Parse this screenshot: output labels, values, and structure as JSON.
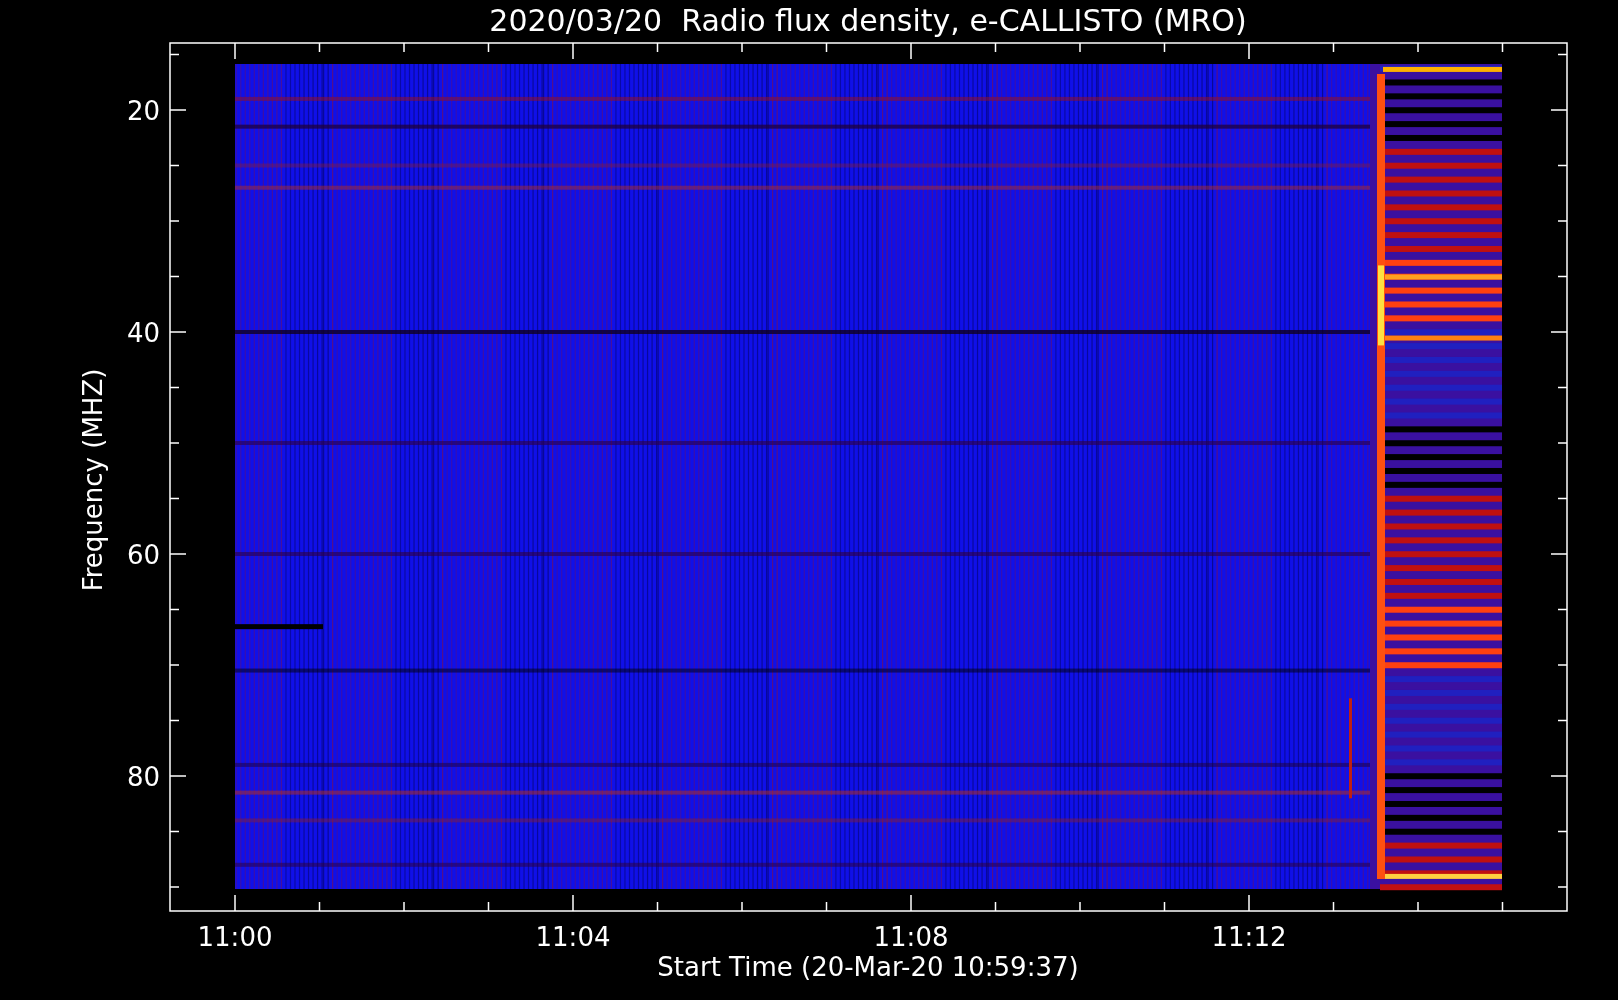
{
  "title": "2020/03/20  Radio flux density, e-CALLISTO (MRO)",
  "y_axis": {
    "label": "Frequency (MHZ)",
    "ticks": [
      "20",
      "40",
      "60",
      "80"
    ]
  },
  "x_axis": {
    "label": "Start Time (20-Mar-20 10:59:37)",
    "ticks": [
      "11:00",
      "11:04",
      "11:08",
      "11:12"
    ]
  }
}
